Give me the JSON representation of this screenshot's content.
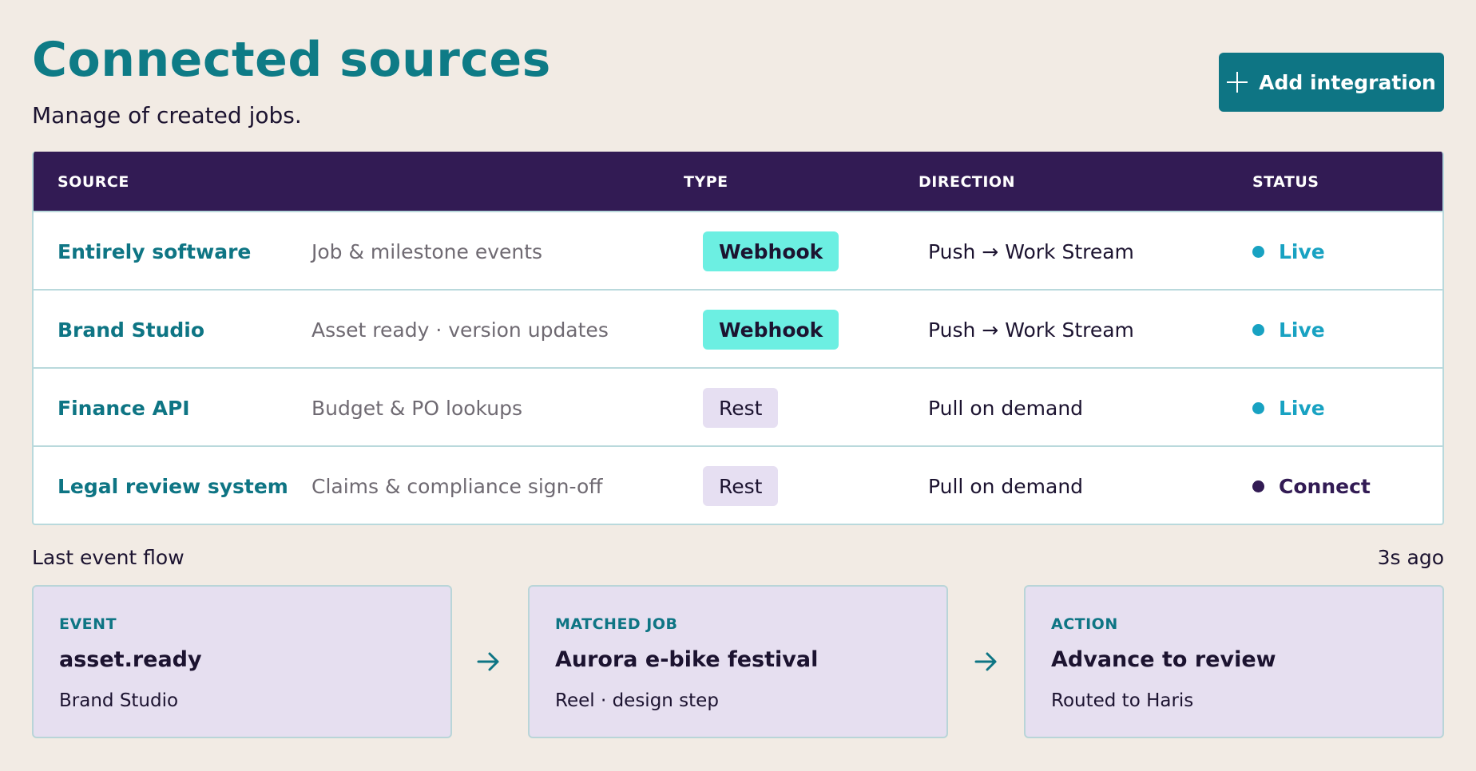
{
  "header": {
    "title": "Connected sources",
    "subtitle": "Manage of created jobs.",
    "add_button_label": "Add integration"
  },
  "table": {
    "columns": [
      "SOURCE",
      "TYPE",
      "DIRECTION",
      "STATUS"
    ],
    "rows": [
      {
        "source": "Entirely software",
        "description": "Job & milestone events",
        "type": "Webhook",
        "direction": "Push → Work Stream",
        "status": "Live"
      },
      {
        "source": "Brand Studio",
        "description": "Asset ready · version updates",
        "type": "Webhook",
        "direction": "Push → Work Stream",
        "status": "Live"
      },
      {
        "source": "Finance API",
        "description": "Budget & PO lookups",
        "type": "Rest",
        "direction": "Pull on demand",
        "status": "Live"
      },
      {
        "source": "Legal review system",
        "description": "Claims & compliance sign-off",
        "type": "Rest",
        "direction": "Pull on demand",
        "status": "Connect"
      }
    ]
  },
  "flow": {
    "label": "Last event flow",
    "timestamp": "3s ago",
    "steps": [
      {
        "kicker": "EVENT",
        "title": "asset.ready",
        "meta": "Brand Studio"
      },
      {
        "kicker": "MATCHED JOB",
        "title": "Aurora e-bike festival",
        "meta": "Reel · design step"
      },
      {
        "kicker": "ACTION",
        "title": "Advance to review",
        "meta": "Routed to Haris"
      }
    ]
  },
  "colors": {
    "accent": "#0e7584",
    "header_bg": "#321b54",
    "live": "#18a2c2",
    "webhook_pill": "#6cefe2",
    "rest_pill": "#e6dff2",
    "card_bg": "#e6dff0",
    "page_bg": "#f2ebe4"
  },
  "icons": {
    "add_button": "plus-icon",
    "flow_connector": "arrow-right-icon",
    "status": "status-dot-icon"
  }
}
